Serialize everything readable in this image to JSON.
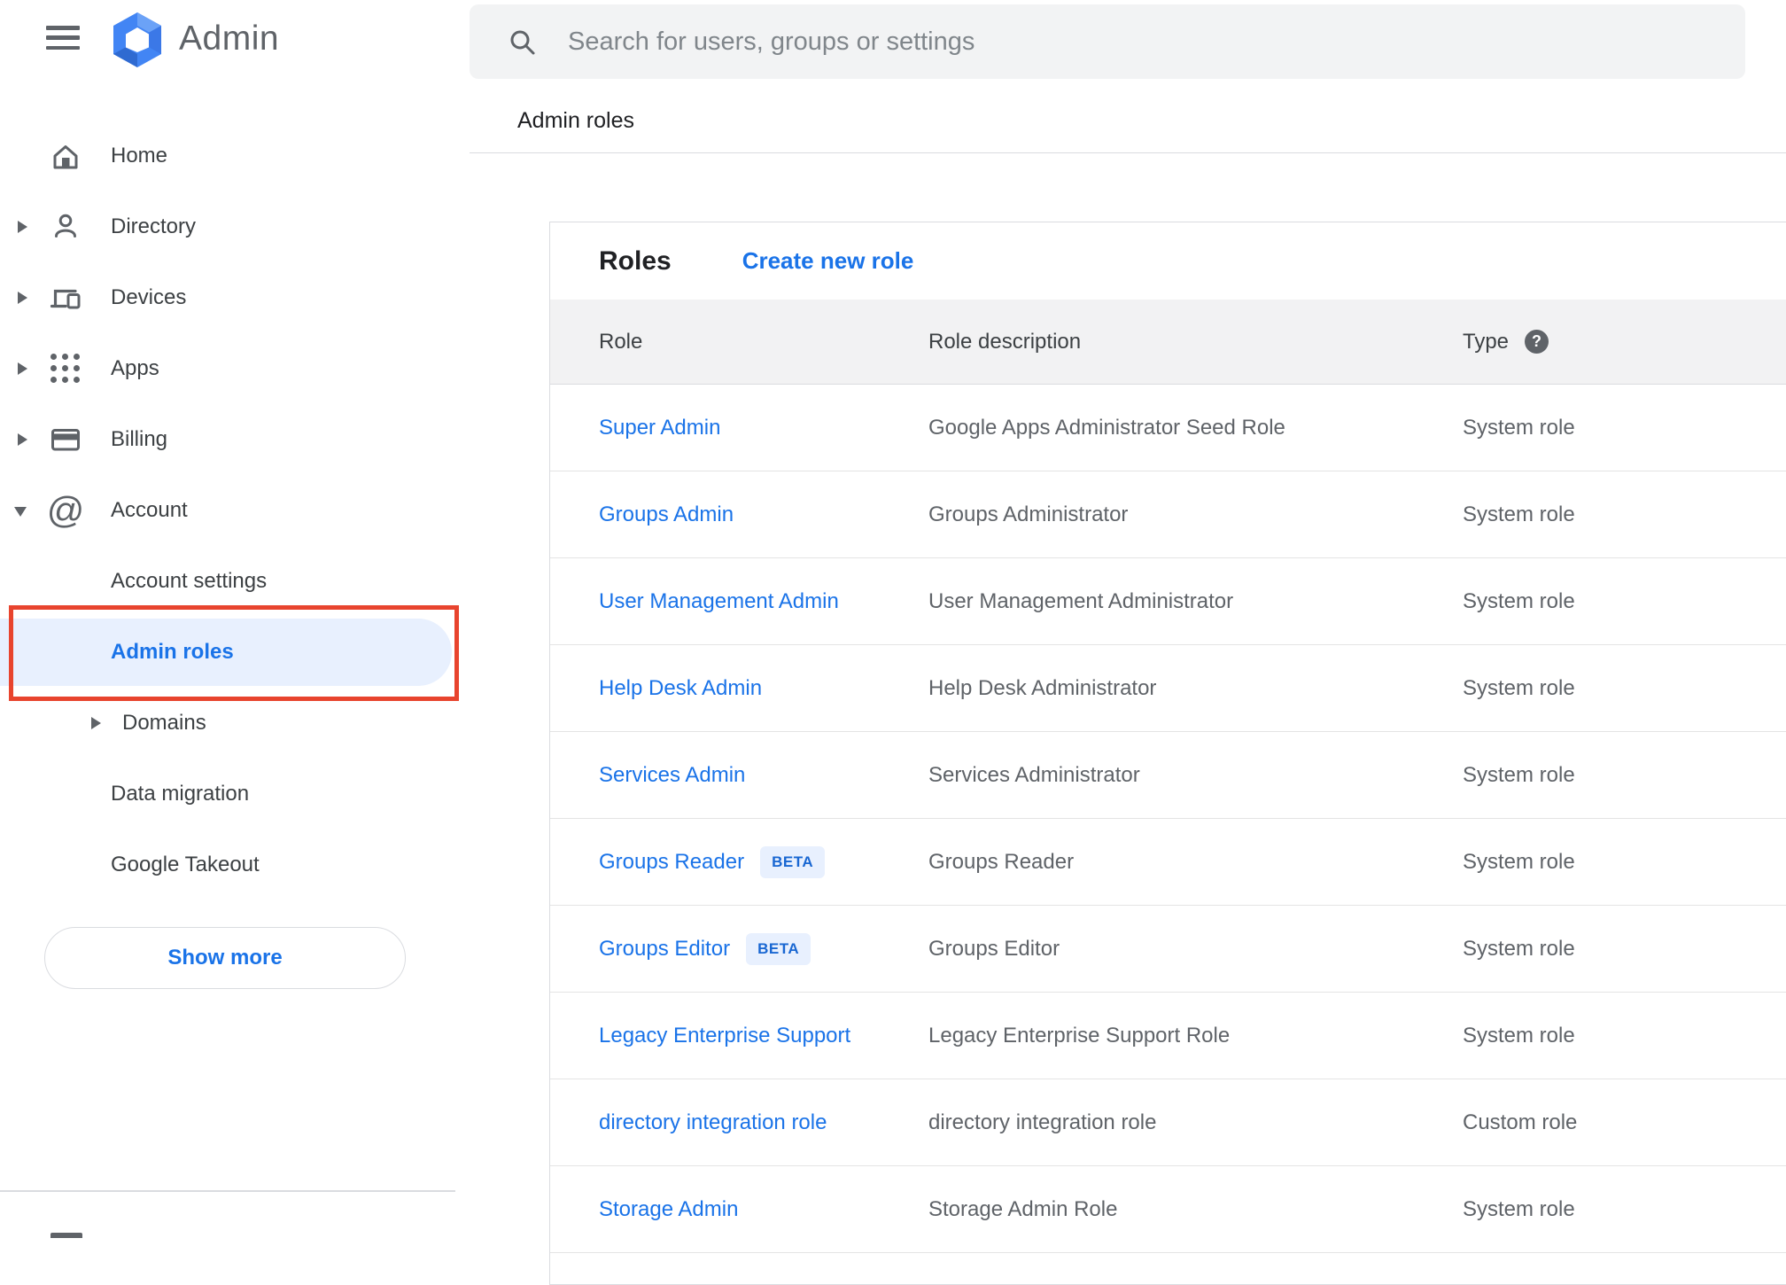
{
  "header": {
    "product_name": "Admin",
    "search_placeholder": "Search for users, groups or settings"
  },
  "breadcrumb": "Admin roles",
  "sidebar": {
    "items": [
      {
        "label": "Home",
        "icon": "home",
        "arrow": "none",
        "level": 0
      },
      {
        "label": "Directory",
        "icon": "person",
        "arrow": "right",
        "level": 0
      },
      {
        "label": "Devices",
        "icon": "devices",
        "arrow": "right",
        "level": 0
      },
      {
        "label": "Apps",
        "icon": "apps",
        "arrow": "right",
        "level": 0
      },
      {
        "label": "Billing",
        "icon": "billing",
        "arrow": "right",
        "level": 0
      },
      {
        "label": "Account",
        "icon": "at",
        "arrow": "down",
        "level": 0
      },
      {
        "label": "Account settings",
        "arrow": "none",
        "level": 1
      },
      {
        "label": "Admin roles",
        "arrow": "none",
        "level": 1,
        "selected": true
      },
      {
        "label": "Domains",
        "arrow": "right",
        "level": 1
      },
      {
        "label": "Data migration",
        "arrow": "none",
        "level": 1
      },
      {
        "label": "Google Takeout",
        "arrow": "none",
        "level": 1
      }
    ],
    "show_more_label": "Show more"
  },
  "main": {
    "title": "Roles",
    "create_link": "Create new role",
    "table": {
      "columns": [
        "Role",
        "Role description",
        "Type"
      ],
      "type_help_glyph": "?",
      "beta_label": "BETA",
      "rows": [
        {
          "role": "Super Admin",
          "beta": false,
          "description": "Google Apps Administrator Seed Role",
          "type": "System role"
        },
        {
          "role": "Groups Admin",
          "beta": false,
          "description": "Groups Administrator",
          "type": "System role"
        },
        {
          "role": "User Management Admin",
          "beta": false,
          "description": "User Management Administrator",
          "type": "System role"
        },
        {
          "role": "Help Desk Admin",
          "beta": false,
          "description": "Help Desk Administrator",
          "type": "System role"
        },
        {
          "role": "Services Admin",
          "beta": false,
          "description": "Services Administrator",
          "type": "System role"
        },
        {
          "role": "Groups Reader",
          "beta": true,
          "description": "Groups Reader",
          "type": "System role"
        },
        {
          "role": "Groups Editor",
          "beta": true,
          "description": "Groups Editor",
          "type": "System role"
        },
        {
          "role": "Legacy Enterprise Support",
          "beta": false,
          "description": "Legacy Enterprise Support Role",
          "type": "System role"
        },
        {
          "role": "directory integration role",
          "beta": false,
          "description": "directory integration role",
          "type": "Custom role"
        },
        {
          "role": "Storage Admin",
          "beta": false,
          "description": "Storage Admin Role",
          "type": "System role"
        }
      ]
    }
  },
  "colors": {
    "accent_blue": "#1a73e8",
    "annotation_red": "#e8442e",
    "selected_pill_bg": "#e8f0fe",
    "beta_badge_bg": "#e8f0fe",
    "beta_badge_text": "#1967d2",
    "table_header_bg": "#f2f2f3",
    "icon_gray": "#5f6368"
  }
}
